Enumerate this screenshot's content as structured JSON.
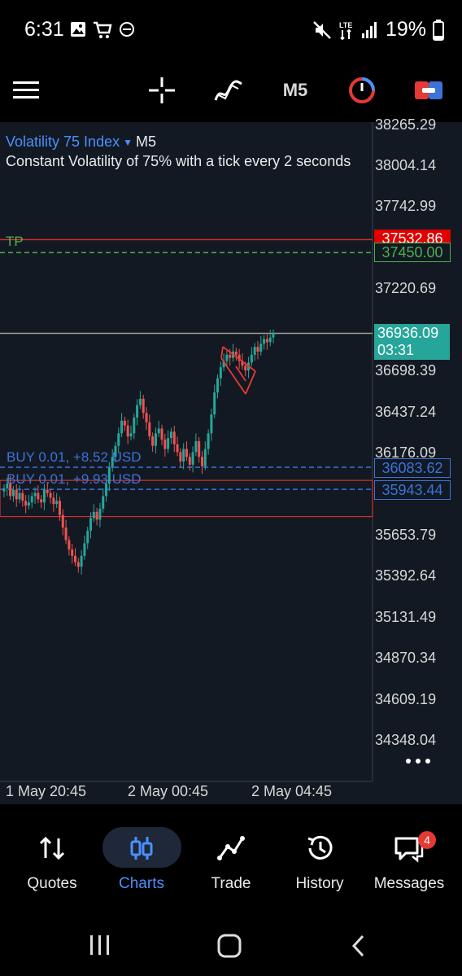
{
  "status_bar": {
    "time": "6:31",
    "battery": "19%",
    "network": "LTE"
  },
  "toolbar": {
    "menu_icon": "hamburger-icon",
    "crosshair_icon": "crosshair-icon",
    "indicators_icon": "indicators-icon",
    "timeframe": "M5",
    "one_click_icon": "one-click-trading-icon",
    "toggle_icon": "toggle-icon"
  },
  "chart": {
    "symbol": "Volatility 75 Index",
    "timeframe": "M5",
    "description": "Constant Volatility of 75% with a tick every 2 seconds",
    "price_scale": [
      "38265.29",
      "38004.14",
      "37742.99",
      "37220.69",
      "36698.39",
      "36437.24",
      "36176.09",
      "35653.79",
      "35392.64",
      "35131.49",
      "34870.34",
      "34609.19",
      "34348.04"
    ],
    "tp_label": "TP",
    "tp_price": "37532.86",
    "tp_pending_price": "37450.00",
    "current_price": "36936.09",
    "countdown": "03:31",
    "positions": [
      {
        "label": "BUY 0.01,  +8.52 USD",
        "price": "36083.62"
      },
      {
        "label": "BUY 0.01,  +9.93 USD",
        "price": "35943.44"
      }
    ],
    "time_labels": [
      "1 May 20:45",
      "2 May 00:45",
      "2 May 04:45"
    ],
    "more_icon": "more-dots-icon",
    "colors": {
      "up": "#26a69a",
      "down": "#ef5350",
      "tp": "#d32f2f",
      "pending": "#4caf50",
      "position": "#3b73d9"
    }
  },
  "chart_data": {
    "type": "candlestick",
    "title": "Volatility 75 Index",
    "timeframe": "M5",
    "x_ticks": [
      "1 May 20:45",
      "2 May 00:45",
      "2 May 04:45"
    ],
    "ylim": [
      34348.04,
      38265.29
    ],
    "y_ticks": [
      38265.29,
      38004.14,
      37742.99,
      37220.69,
      36698.39,
      36437.24,
      36176.09,
      35653.79,
      35392.64,
      35131.49,
      34870.34,
      34609.19,
      34348.04
    ],
    "closes": [
      35950,
      35980,
      35900,
      35940,
      35880,
      35920,
      35870,
      35840,
      35860,
      35900,
      35920,
      35880,
      35860,
      35940,
      35920,
      35890,
      35850,
      35870,
      35780,
      35700,
      35620,
      35560,
      35520,
      35480,
      35450,
      35520,
      35600,
      35680,
      35760,
      35800,
      35750,
      35820,
      35900,
      35980,
      36080,
      36150,
      36220,
      36300,
      36380,
      36350,
      36280,
      36300,
      36400,
      36480,
      36520,
      36430,
      36370,
      36280,
      36220,
      36300,
      36330,
      36260,
      36200,
      36270,
      36310,
      36230,
      36180,
      36120,
      36200,
      36150,
      36100,
      36180,
      36250,
      36150,
      36090,
      36200,
      36300,
      36420,
      36560,
      36650,
      36720,
      36760,
      36800,
      36780,
      36820,
      36800,
      36760,
      36730,
      36700,
      36750,
      36800,
      36850,
      36820,
      36870,
      36900,
      36880,
      36910,
      36936.09
    ],
    "horizontal_lines": [
      {
        "name": "TP",
        "price": 37532.86
      },
      {
        "name": "TP pending",
        "price": 37450.0
      },
      {
        "name": "BUY 0.01,  +8.52 USD",
        "price": 36083.62
      },
      {
        "name": "BUY 0.01,  +9.93 USD",
        "price": 35943.44
      },
      {
        "name": "Current price",
        "price": 36936.09
      }
    ]
  },
  "bottom_nav": [
    {
      "label": "Quotes",
      "icon": "quotes-icon",
      "active": false
    },
    {
      "label": "Charts",
      "icon": "charts-icon",
      "active": true
    },
    {
      "label": "Trade",
      "icon": "trade-icon",
      "active": false
    },
    {
      "label": "History",
      "icon": "history-icon",
      "active": false
    },
    {
      "label": "Messages",
      "icon": "messages-icon",
      "active": false,
      "badge": "4"
    }
  ],
  "system_nav": {
    "recents_icon": "recents-icon",
    "home_icon": "home-icon",
    "back_icon": "back-icon"
  }
}
